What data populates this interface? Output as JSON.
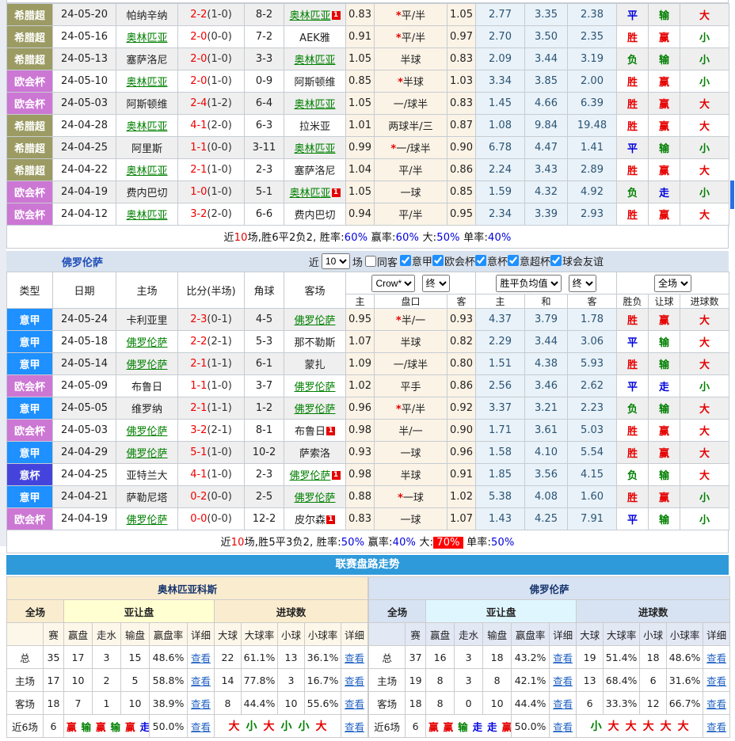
{
  "ui": {
    "view": "查看"
  },
  "top_table": {
    "rows": [
      {
        "lg": "希腊超",
        "lgc": "gr",
        "date": "24-05-20",
        "home": "帕纳辛纳",
        "hc": "n",
        "hb": "",
        "score": "2-2",
        "half": "(1-0)",
        "corner": "8-2",
        "away": "奥林匹亚",
        "ac": "f",
        "ab": "1",
        "o1": "0.83",
        "hs": "*",
        "hcap": "平/半",
        "o2": "1.05",
        "m1": "2.77",
        "m2": "3.35",
        "m3": "2.38",
        "r1": "平",
        "r1c": "b",
        "r2": "输",
        "r2c": "g",
        "r3": "大",
        "r3c": "r"
      },
      {
        "lg": "希腊超",
        "lgc": "gr",
        "date": "24-05-16",
        "home": "奥林匹亚",
        "hc": "f",
        "hb": "",
        "score": "2-0",
        "half": "(0-0)",
        "corner": "7-2",
        "away": "AEK雅",
        "ac": "n",
        "ab": "",
        "o1": "0.91",
        "hs": "*",
        "hcap": "平/半",
        "o2": "0.97",
        "m1": "2.70",
        "m2": "3.50",
        "m3": "2.35",
        "r1": "胜",
        "r1c": "r",
        "r2": "赢",
        "r2c": "r",
        "r3": "小",
        "r3c": "g"
      },
      {
        "lg": "希腊超",
        "lgc": "gr",
        "date": "24-05-13",
        "home": "塞萨洛尼",
        "hc": "n",
        "hb": "",
        "score": "2-0",
        "half": "(1-0)",
        "corner": "3-3",
        "away": "奥林匹亚",
        "ac": "f",
        "ab": "",
        "o1": "1.05",
        "hs": "",
        "hcap": "半球",
        "o2": "0.83",
        "m1": "2.09",
        "m2": "3.44",
        "m3": "3.19",
        "r1": "负",
        "r1c": "g",
        "r2": "输",
        "r2c": "g",
        "r3": "小",
        "r3c": "g"
      },
      {
        "lg": "欧会杯",
        "lgc": "ec",
        "date": "24-05-10",
        "home": "奥林匹亚",
        "hc": "f",
        "hb": "",
        "score": "2-0",
        "half": "(1-0)",
        "corner": "0-9",
        "away": "阿斯顿维",
        "ac": "n",
        "ab": "",
        "o1": "0.85",
        "hs": "*",
        "hcap": "半球",
        "o2": "1.03",
        "m1": "3.34",
        "m2": "3.85",
        "m3": "2.00",
        "r1": "胜",
        "r1c": "r",
        "r2": "赢",
        "r2c": "r",
        "r3": "小",
        "r3c": "g"
      },
      {
        "lg": "欧会杯",
        "lgc": "ec",
        "date": "24-05-03",
        "home": "阿斯顿维",
        "hc": "n",
        "hb": "",
        "score": "2-4",
        "half": "(1-2)",
        "corner": "6-4",
        "away": "奥林匹亚",
        "ac": "f",
        "ab": "",
        "o1": "1.05",
        "hs": "",
        "hcap": "一/球半",
        "o2": "0.83",
        "m1": "1.45",
        "m2": "4.66",
        "m3": "6.39",
        "r1": "胜",
        "r1c": "r",
        "r2": "赢",
        "r2c": "r",
        "r3": "大",
        "r3c": "r"
      },
      {
        "lg": "希腊超",
        "lgc": "gr",
        "date": "24-04-28",
        "home": "奥林匹亚",
        "hc": "f",
        "hb": "",
        "score": "4-1",
        "half": "(2-0)",
        "corner": "6-3",
        "away": "拉米亚",
        "ac": "n",
        "ab": "",
        "o1": "1.01",
        "hs": "",
        "hcap": "两球半/三",
        "o2": "0.87",
        "m1": "1.08",
        "m2": "9.84",
        "m3": "19.48",
        "r1": "胜",
        "r1c": "r",
        "r2": "赢",
        "r2c": "r",
        "r3": "大",
        "r3c": "r"
      },
      {
        "lg": "希腊超",
        "lgc": "gr",
        "date": "24-04-25",
        "home": "阿里斯",
        "hc": "n",
        "hb": "",
        "score": "1-1",
        "half": "(0-0)",
        "corner": "3-11",
        "away": "奥林匹亚",
        "ac": "f",
        "ab": "",
        "o1": "0.99",
        "hs": "*",
        "hcap": "一/球半",
        "o2": "0.90",
        "m1": "6.78",
        "m2": "4.47",
        "m3": "1.41",
        "r1": "平",
        "r1c": "b",
        "r2": "输",
        "r2c": "g",
        "r3": "小",
        "r3c": "g"
      },
      {
        "lg": "希腊超",
        "lgc": "gr",
        "date": "24-04-22",
        "home": "奥林匹亚",
        "hc": "f",
        "hb": "",
        "score": "2-1",
        "half": "(1-0)",
        "corner": "2-3",
        "away": "塞萨洛尼",
        "ac": "n",
        "ab": "",
        "o1": "1.04",
        "hs": "",
        "hcap": "平/半",
        "o2": "0.86",
        "m1": "2.24",
        "m2": "3.43",
        "m3": "2.89",
        "r1": "胜",
        "r1c": "r",
        "r2": "赢",
        "r2c": "r",
        "r3": "大",
        "r3c": "r"
      },
      {
        "lg": "欧会杯",
        "lgc": "ec",
        "date": "24-04-19",
        "home": "费内巴切",
        "hc": "n",
        "hb": "",
        "score": "1-0",
        "half": "(1-0)",
        "corner": "5-1",
        "away": "奥林匹亚",
        "ac": "f",
        "ab": "1",
        "o1": "1.05",
        "hs": "",
        "hcap": "一球",
        "o2": "0.85",
        "m1": "1.59",
        "m2": "4.32",
        "m3": "4.92",
        "r1": "负",
        "r1c": "g",
        "r2": "走",
        "r2c": "b",
        "r3": "小",
        "r3c": "g"
      },
      {
        "lg": "欧会杯",
        "lgc": "ec",
        "date": "24-04-12",
        "home": "奥林匹亚",
        "hc": "f",
        "hb": "",
        "score": "3-2",
        "half": "(2-0)",
        "corner": "6-6",
        "away": "费内巴切",
        "ac": "n",
        "ab": "",
        "o1": "0.94",
        "hs": "",
        "hcap": "平/半",
        "o2": "0.95",
        "m1": "2.34",
        "m2": "3.39",
        "m3": "2.93",
        "r1": "胜",
        "r1c": "r",
        "r2": "赢",
        "r2c": "r",
        "r3": "大",
        "r3c": "r"
      }
    ],
    "summary": [
      {
        "t": "近",
        "c": "k"
      },
      {
        "t": "10",
        "c": "r"
      },
      {
        "t": "场,胜6平2负2, 胜率:",
        "c": "k"
      },
      {
        "t": "60%",
        "c": "b"
      },
      {
        "t": " 赢率:",
        "c": "k"
      },
      {
        "t": "60%",
        "c": "b"
      },
      {
        "t": " 大:",
        "c": "k"
      },
      {
        "t": "50%",
        "c": "b"
      },
      {
        "t": " 单率:",
        "c": "k"
      },
      {
        "t": "40%",
        "c": "b"
      }
    ]
  },
  "section": {
    "team": "佛罗伦萨",
    "near_label": "近",
    "count": "10",
    "games_label": "场",
    "same_away_label": "同客",
    "filters": [
      {
        "label": "意甲"
      },
      {
        "label": "欧会杯"
      },
      {
        "label": "意杯"
      },
      {
        "label": "意超杯"
      },
      {
        "label": "球会友谊"
      }
    ],
    "selects": {
      "odds_src": "Crow*",
      "odds_state": "终",
      "mean": "胜平负均值",
      "mean_state": "终",
      "scope": "全场"
    }
  },
  "table_headers": {
    "type": "类型",
    "date": "日期",
    "home": "主场",
    "score": "比分(半场)",
    "corner": "角球",
    "away": "客场",
    "h": "主",
    "pan": "盘口",
    "a": "客",
    "m_h": "主",
    "m_d": "和",
    "m_a": "客",
    "wdl": "胜负",
    "rang": "让球",
    "goals": "进球数"
  },
  "fio_table": {
    "rows": [
      {
        "lg": "意甲",
        "lgc": "sa",
        "date": "24-05-24",
        "home": "卡利亚里",
        "hc": "n",
        "hb": "",
        "score": "2-3",
        "half": "(0-1)",
        "corner": "4-5",
        "away": "佛罗伦萨",
        "ac": "f",
        "ab": "",
        "o1": "0.95",
        "hs": "*",
        "hcap": "半/一",
        "o2": "0.93",
        "m1": "4.37",
        "m2": "3.79",
        "m3": "1.78",
        "r1": "胜",
        "r1c": "r",
        "r2": "赢",
        "r2c": "r",
        "r3": "大",
        "r3c": "r"
      },
      {
        "lg": "意甲",
        "lgc": "sa",
        "date": "24-05-18",
        "home": "佛罗伦萨",
        "hc": "f",
        "hb": "",
        "score": "2-2",
        "half": "(2-1)",
        "corner": "5-3",
        "away": "那不勒斯",
        "ac": "n",
        "ab": "",
        "o1": "1.07",
        "hs": "",
        "hcap": "半球",
        "o2": "0.82",
        "m1": "2.29",
        "m2": "3.44",
        "m3": "3.06",
        "r1": "平",
        "r1c": "b",
        "r2": "输",
        "r2c": "g",
        "r3": "大",
        "r3c": "r"
      },
      {
        "lg": "意甲",
        "lgc": "sa",
        "date": "24-05-14",
        "home": "佛罗伦萨",
        "hc": "f",
        "hb": "",
        "score": "2-1",
        "half": "(1-1)",
        "corner": "6-1",
        "away": "蒙扎",
        "ac": "n",
        "ab": "",
        "o1": "1.09",
        "hs": "",
        "hcap": "一/球半",
        "o2": "0.80",
        "m1": "1.51",
        "m2": "4.38",
        "m3": "5.93",
        "r1": "胜",
        "r1c": "r",
        "r2": "输",
        "r2c": "g",
        "r3": "大",
        "r3c": "r"
      },
      {
        "lg": "欧会杯",
        "lgc": "ec",
        "date": "24-05-09",
        "home": "布鲁日",
        "hc": "n",
        "hb": "",
        "score": "1-1",
        "half": "(1-0)",
        "corner": "3-7",
        "away": "佛罗伦萨",
        "ac": "f",
        "ab": "",
        "o1": "1.02",
        "hs": "",
        "hcap": "平手",
        "o2": "0.86",
        "m1": "2.56",
        "m2": "3.46",
        "m3": "2.62",
        "r1": "平",
        "r1c": "b",
        "r2": "走",
        "r2c": "b",
        "r3": "小",
        "r3c": "g"
      },
      {
        "lg": "意甲",
        "lgc": "sa",
        "date": "24-05-05",
        "home": "维罗纳",
        "hc": "n",
        "hb": "",
        "score": "2-1",
        "half": "(1-1)",
        "corner": "1-2",
        "away": "佛罗伦萨",
        "ac": "f",
        "ab": "",
        "o1": "0.96",
        "hs": "*",
        "hcap": "平/半",
        "o2": "0.92",
        "m1": "3.37",
        "m2": "3.21",
        "m3": "2.23",
        "r1": "负",
        "r1c": "g",
        "r2": "输",
        "r2c": "g",
        "r3": "大",
        "r3c": "r"
      },
      {
        "lg": "欧会杯",
        "lgc": "ec",
        "date": "24-05-03",
        "home": "佛罗伦萨",
        "hc": "f",
        "hb": "",
        "score": "3-2",
        "half": "(2-1)",
        "corner": "8-1",
        "away": "布鲁日",
        "ac": "n",
        "ab": "1",
        "o1": "0.98",
        "hs": "",
        "hcap": "半/一",
        "o2": "0.90",
        "m1": "1.71",
        "m2": "3.61",
        "m3": "5.03",
        "r1": "胜",
        "r1c": "r",
        "r2": "赢",
        "r2c": "r",
        "r3": "大",
        "r3c": "r"
      },
      {
        "lg": "意甲",
        "lgc": "sa",
        "date": "24-04-29",
        "home": "佛罗伦萨",
        "hc": "f",
        "hb": "",
        "score": "5-1",
        "half": "(1-0)",
        "corner": "10-2",
        "away": "萨索洛",
        "ac": "n",
        "ab": "",
        "o1": "0.93",
        "hs": "",
        "hcap": "一球",
        "o2": "0.96",
        "m1": "1.58",
        "m2": "4.10",
        "m3": "5.54",
        "r1": "胜",
        "r1c": "r",
        "r2": "赢",
        "r2c": "r",
        "r3": "大",
        "r3c": "r"
      },
      {
        "lg": "意杯",
        "lgc": "ci",
        "date": "24-04-25",
        "home": "亚特兰大",
        "hc": "n",
        "hb": "",
        "score": "4-1",
        "half": "(1-0)",
        "corner": "2-3",
        "away": "佛罗伦萨",
        "ac": "f",
        "ab": "1",
        "o1": "0.98",
        "hs": "",
        "hcap": "半球",
        "o2": "0.91",
        "m1": "1.85",
        "m2": "3.56",
        "m3": "4.15",
        "r1": "负",
        "r1c": "g",
        "r2": "输",
        "r2c": "g",
        "r3": "大",
        "r3c": "r"
      },
      {
        "lg": "意甲",
        "lgc": "sa",
        "date": "24-04-21",
        "home": "萨勒尼塔",
        "hc": "n",
        "hb": "",
        "score": "0-2",
        "half": "(0-0)",
        "corner": "2-5",
        "away": "佛罗伦萨",
        "ac": "f",
        "ab": "",
        "o1": "0.88",
        "hs": "*",
        "hcap": "一球",
        "o2": "1.02",
        "m1": "5.38",
        "m2": "4.08",
        "m3": "1.60",
        "r1": "胜",
        "r1c": "r",
        "r2": "赢",
        "r2c": "r",
        "r3": "小",
        "r3c": "g"
      },
      {
        "lg": "欧会杯",
        "lgc": "ec",
        "date": "24-04-19",
        "home": "佛罗伦萨",
        "hc": "f",
        "hb": "",
        "score": "0-0",
        "half": "(0-0)",
        "corner": "12-2",
        "away": "皮尔森",
        "ac": "n",
        "ab": "1",
        "o1": "0.83",
        "hs": "",
        "hcap": "一球",
        "o2": "1.07",
        "m1": "1.43",
        "m2": "4.25",
        "m3": "7.91",
        "r1": "平",
        "r1c": "b",
        "r2": "输",
        "r2c": "g",
        "r3": "小",
        "r3c": "g"
      }
    ],
    "summary": [
      {
        "t": "近",
        "c": "k"
      },
      {
        "t": "10",
        "c": "r"
      },
      {
        "t": "场,胜5平3负2, 胜率:",
        "c": "k"
      },
      {
        "t": "50%",
        "c": "b"
      },
      {
        "t": " 赢率:",
        "c": "k"
      },
      {
        "t": "40%",
        "c": "b"
      },
      {
        "t": " 大:",
        "c": "k"
      },
      {
        "t": "70%",
        "c": "chip"
      },
      {
        "t": " 单率:",
        "c": "k"
      },
      {
        "t": "50%",
        "c": "b"
      }
    ]
  },
  "bottom": {
    "banner": "联赛盘路走势",
    "headers": {
      "all": "全场",
      "asian": "亚让盘",
      "goals": "进球数",
      "sub": [
        "",
        "赛",
        "赢盘",
        "走水",
        "输盘",
        "赢盘率",
        "详细",
        "大球",
        "大球率",
        "小球",
        "小球率",
        "详细"
      ],
      "view": "查看"
    },
    "left": {
      "title": "奥林匹亚科斯",
      "rows": [
        {
          "label": "总",
          "g": "35",
          "w": "17",
          "p": "3",
          "l": "15",
          "wr": "48.6%",
          "ov": "22",
          "ovr": "61.1%",
          "un": "13",
          "unr": "36.1%"
        },
        {
          "label": "主场",
          "g": "17",
          "w": "10",
          "p": "2",
          "l": "5",
          "wr": "58.8%",
          "ov": "14",
          "ovr": "77.8%",
          "un": "3",
          "unr": "16.7%"
        },
        {
          "label": "客场",
          "g": "18",
          "w": "7",
          "p": "1",
          "l": "10",
          "wr": "38.9%",
          "ov": "8",
          "ovr": "44.4%",
          "un": "10",
          "unr": "55.6%"
        }
      ],
      "near6": {
        "label": "近6场",
        "g": "6",
        "wr": "50.0%",
        "seq": [
          {
            "t": "赢",
            "c": "r"
          },
          {
            "t": "输",
            "c": "g"
          },
          {
            "t": "赢",
            "c": "r"
          },
          {
            "t": "输",
            "c": "g"
          },
          {
            "t": "赢",
            "c": "r"
          },
          {
            "t": "走",
            "c": "b"
          }
        ],
        "big": [
          {
            "t": "大",
            "c": "r"
          },
          {
            "t": "小",
            "c": "g"
          },
          {
            "t": "大",
            "c": "r"
          },
          {
            "t": "小",
            "c": "g"
          },
          {
            "t": "小",
            "c": "g"
          },
          {
            "t": "大",
            "c": "r"
          }
        ]
      }
    },
    "right": {
      "title": "佛罗伦萨",
      "rows": [
        {
          "label": "总",
          "g": "37",
          "w": "16",
          "p": "3",
          "l": "18",
          "wr": "43.2%",
          "ov": "19",
          "ovr": "51.4%",
          "un": "18",
          "unr": "48.6%"
        },
        {
          "label": "主场",
          "g": "19",
          "w": "8",
          "p": "3",
          "l": "8",
          "wr": "42.1%",
          "ov": "13",
          "ovr": "68.4%",
          "un": "6",
          "unr": "31.6%"
        },
        {
          "label": "客场",
          "g": "18",
          "w": "8",
          "p": "0",
          "l": "10",
          "wr": "44.4%",
          "ov": "6",
          "ovr": "33.3%",
          "un": "12",
          "unr": "66.7%"
        }
      ],
      "near6": {
        "label": "近6场",
        "g": "6",
        "wr": "50.0%",
        "seq": [
          {
            "t": "赢",
            "c": "r"
          },
          {
            "t": "赢",
            "c": "r"
          },
          {
            "t": "输",
            "c": "g"
          },
          {
            "t": "走",
            "c": "b"
          },
          {
            "t": "走",
            "c": "b"
          },
          {
            "t": "赢",
            "c": "r"
          }
        ],
        "big": [
          {
            "t": "小",
            "c": "g"
          },
          {
            "t": "大",
            "c": "r"
          },
          {
            "t": "大",
            "c": "r"
          },
          {
            "t": "大",
            "c": "r"
          },
          {
            "t": "大",
            "c": "r"
          },
          {
            "t": "大",
            "c": "r"
          }
        ]
      }
    }
  }
}
